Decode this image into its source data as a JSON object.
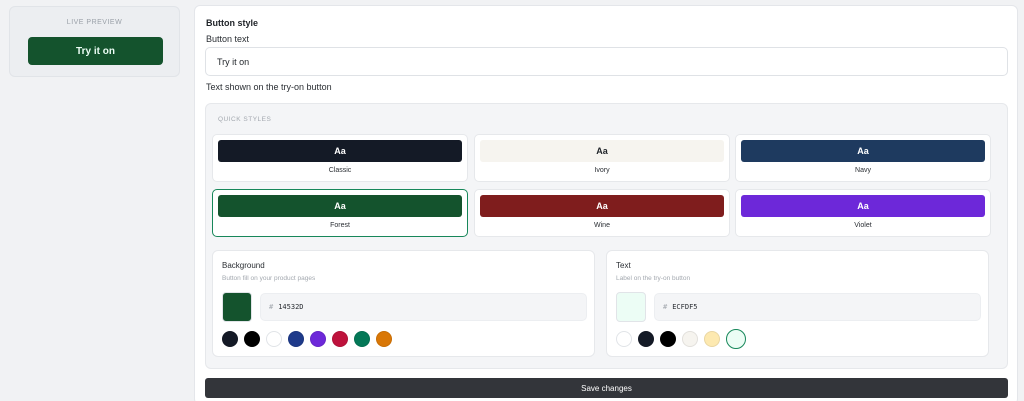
{
  "preview": {
    "label": "LIVE PREVIEW",
    "button_text": "Try it on",
    "bg": "#14532D",
    "fg": "#ECFDF5"
  },
  "panel": {
    "title": "Button style",
    "field_label": "Button text",
    "input_value": "Try it on",
    "help_text": "Text shown on the try-on button"
  },
  "quick_styles": {
    "title": "QUICK STYLES",
    "sample": "Aa",
    "items": [
      {
        "name": "Classic",
        "bg": "#141a26",
        "fg": "#ffffff"
      },
      {
        "name": "Ivory",
        "bg": "#f6f4ef",
        "fg": "#1f2328"
      },
      {
        "name": "Navy",
        "bg": "#1e3a5f",
        "fg": "#ffffff"
      },
      {
        "name": "Forest",
        "bg": "#14532d",
        "fg": "#ffffff",
        "selected": true
      },
      {
        "name": "Wine",
        "bg": "#7f1d1d",
        "fg": "#ffffff"
      },
      {
        "name": "Violet",
        "bg": "#6d28d9",
        "fg": "#ffffff"
      }
    ]
  },
  "background": {
    "title": "Background",
    "subtitle": "Button fill on your product pages",
    "hash": "#",
    "hex": "14532D",
    "color": "#14532d",
    "swatches": [
      "#141a26",
      "#000000",
      "#ffffff",
      "#1e3a8a",
      "#6d28d9",
      "#be123c",
      "#047857",
      "#d97706"
    ]
  },
  "text": {
    "title": "Text",
    "subtitle": "Label on the try-on button",
    "hash": "#",
    "hex": "ECFDF5",
    "color": "#ecfdf5",
    "swatches": [
      "#ffffff",
      "#141a26",
      "#000000",
      "#f6f4ef",
      "#fde9b0",
      "#ecfdf5"
    ]
  },
  "save_label": "Save changes"
}
